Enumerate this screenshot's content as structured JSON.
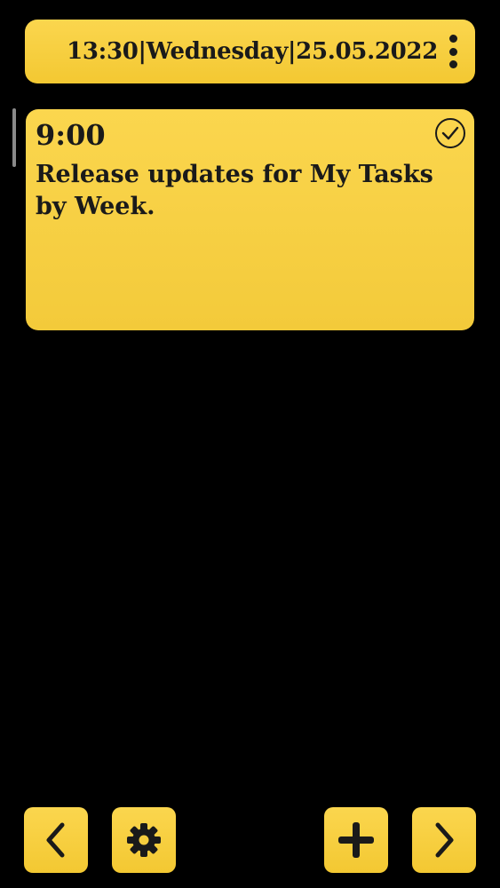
{
  "header": {
    "datetime": "13:30|Wednesday|25.05.2022",
    "menu_icon": "more-vertical-icon"
  },
  "tasks": [
    {
      "time": "9:00",
      "text": "Release updates for My Tasks by Week.",
      "completed": false,
      "status_icon": "check-circle-icon"
    }
  ],
  "toolbar": {
    "prev_icon": "chevron-left-icon",
    "settings_icon": "gear-icon",
    "add_icon": "plus-icon",
    "next_icon": "chevron-right-icon"
  },
  "colors": {
    "background": "#000000",
    "card": "#f8d045",
    "text": "#1a1a1a"
  }
}
